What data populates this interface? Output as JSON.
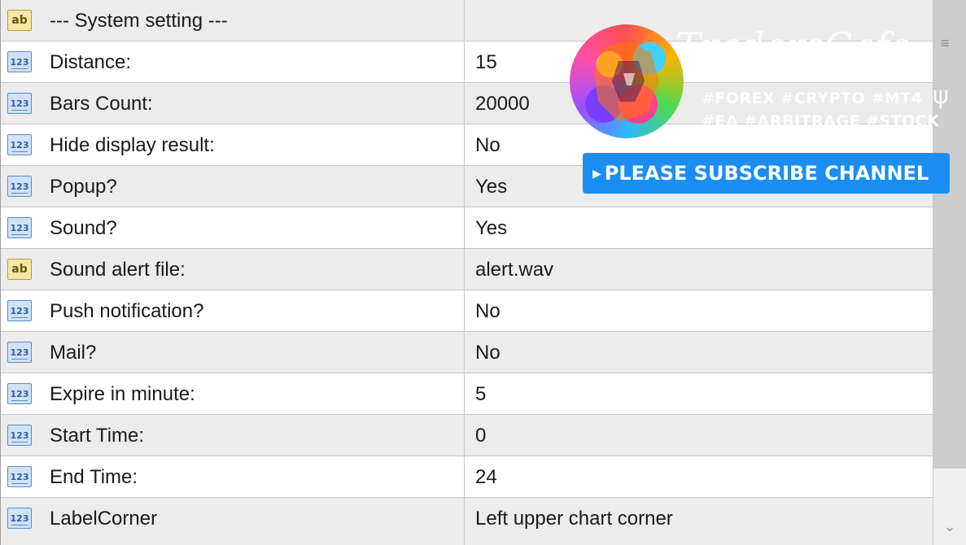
{
  "parameters": [
    {
      "type": "ab",
      "name": "--- System setting ---",
      "value": ""
    },
    {
      "type": "123",
      "name": "Distance:",
      "value": "15"
    },
    {
      "type": "123",
      "name": "Bars Count:",
      "value": "20000"
    },
    {
      "type": "123",
      "name": "Hide display result:",
      "value": "No"
    },
    {
      "type": "123",
      "name": "Popup?",
      "value": "Yes"
    },
    {
      "type": "123",
      "name": "Sound?",
      "value": "Yes"
    },
    {
      "type": "ab",
      "name": "Sound alert file:",
      "value": "alert.wav"
    },
    {
      "type": "123",
      "name": "Push notification?",
      "value": "No"
    },
    {
      "type": "123",
      "name": "Mail?",
      "value": "No"
    },
    {
      "type": "123",
      "name": "Expire in minute:",
      "value": "5"
    },
    {
      "type": "123",
      "name": "Start Time:",
      "value": "0"
    },
    {
      "type": "123",
      "name": "End Time:",
      "value": "24"
    },
    {
      "type": "123",
      "name": "LabelCorner",
      "value": "Left upper chart corner"
    }
  ],
  "type_icons": {
    "number": "123",
    "string": "ab"
  },
  "overlay": {
    "brand": "TradersCafe",
    "tags_line1": "#FOREX #CRYPTO #MT4",
    "tags_line2": "#EA #ARBITRAGE #STOCK",
    "subscribe_label": "PLEASE SUBSCRIBE CHANNEL",
    "subscribe_color": "#1a8ef2"
  },
  "colors": {
    "row_alt": "#ececec",
    "row_plain": "#ffffff",
    "grid_line": "#c8c8c8"
  }
}
